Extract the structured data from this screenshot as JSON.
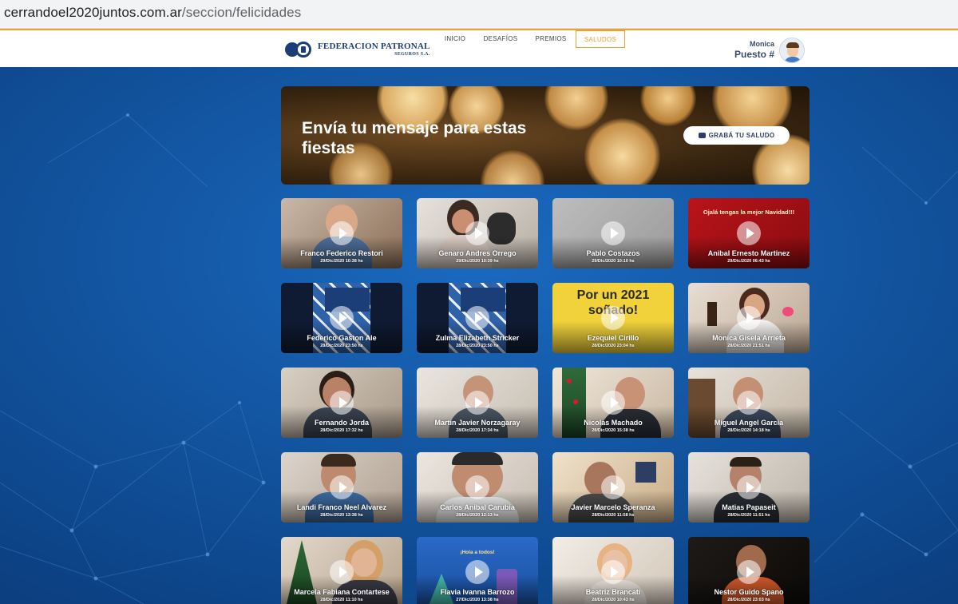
{
  "browser": {
    "url_host": "cerrandoel2020juntos.com.ar",
    "url_path": "/seccion/felicidades"
  },
  "header": {
    "logo_line1": "FEDERACION PATRONAL",
    "logo_line2": "SEGUROS S.A.",
    "nav": [
      "INICIO",
      "DESAFÍOS",
      "PREMIOS",
      "SALUDOS"
    ],
    "active_nav": "SALUDOS",
    "user_name": "Monica",
    "user_rank": "Puesto #"
  },
  "banner": {
    "title": "Envía tu mensaje para estas fiestas",
    "button": "GRABÁ TU SALUDO"
  },
  "videos": [
    {
      "name": "Franco Federico Restori",
      "date": "29/Dic/2020 10:38 hs"
    },
    {
      "name": "Genaro Andres Orrego",
      "date": "29/Dic/2020 10:39 hs"
    },
    {
      "name": "Pablo Costazos",
      "date": "29/Dic/2020 10:10 hs"
    },
    {
      "name": "Anibal Ernesto Martinez",
      "date": "29/Dic/2020 06:43 hs",
      "overlay": "Ojalá tengas la mejor Navidad!!!"
    },
    {
      "name": "Federico Gaston Ale",
      "date": "28/Dic/2020 23:50 hs"
    },
    {
      "name": "Zulma Elizabeth Stricker",
      "date": "28/Dic/2020 23:50 hs"
    },
    {
      "name": "Ezequiel Cirillo",
      "date": "28/Dic/2020 23:04 hs",
      "overlay": "Por un 2021 soñado!"
    },
    {
      "name": "Monica Gisela Arrieta",
      "date": "28/Dic/2020 21:51 hs"
    },
    {
      "name": "Fernando Jorda",
      "date": "28/Dic/2020 17:32 hs"
    },
    {
      "name": "Martin Javier Norzagaray",
      "date": "28/Dic/2020 17:34 hs"
    },
    {
      "name": "Nicolas Machado",
      "date": "28/Dic/2020 15:38 hs"
    },
    {
      "name": "Miguel Angel Garcia",
      "date": "28/Dic/2020 14:18 hs"
    },
    {
      "name": "Landi Franco Neel Alvarez",
      "date": "28/Dic/2020 13:38 hs"
    },
    {
      "name": "Carlos Anibal Carubia",
      "date": "28/Dic/2020 12:13 hs"
    },
    {
      "name": "Javier Marcelo Speranza",
      "date": "28/Dic/2020 11:58 hs"
    },
    {
      "name": "Matias Papaseit",
      "date": "28/Dic/2020 11:51 hs"
    },
    {
      "name": "Marcela Fabiana Contartese",
      "date": "28/Dic/2020 11:10 hs"
    },
    {
      "name": "Flavia Ivanna Barrozo",
      "date": "27/Dic/2020 13:38 hs",
      "overlay": "¡Hola a todos!"
    },
    {
      "name": "Beatriz Brancati",
      "date": "28/Dic/2020 10:43 hs"
    },
    {
      "name": "Nestor Guido Spano",
      "date": "28/Dic/2020 23:03 hs"
    }
  ],
  "colors": {
    "accent": "#f0a030",
    "brand": "#1c3e78",
    "page_bg": "#0f4f9a"
  }
}
